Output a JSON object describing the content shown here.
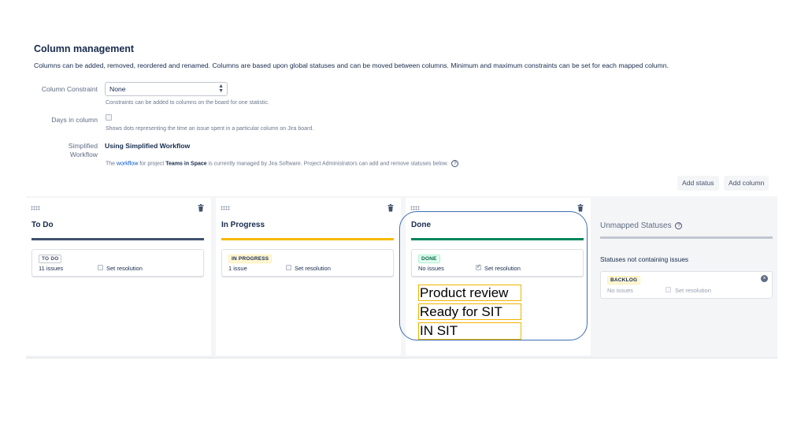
{
  "header": {
    "title": "Column management",
    "description": "Columns can be added, removed, reordered and renamed. Columns are based upon global statuses and can be moved between columns. Minimum and maximum constraints can be set for each mapped column."
  },
  "form": {
    "constraint_label": "Column Constraint",
    "constraint_value": "None",
    "constraint_help": "Constraints can be added to columns on the board for one statistic.",
    "days_label": "Days in column",
    "days_help": "Shows dots representing the time an issue spent in a particular column on Jira board.",
    "workflow_label_1": "Simplified",
    "workflow_label_2": "Workflow",
    "workflow_value": "Using Simplified Workflow",
    "workflow_help_pre": "The",
    "workflow_link": "workflow",
    "workflow_help_mid": "for project",
    "workflow_project": "Teams in Space",
    "workflow_help_post": "is currently managed by Jira Software. Project Administrators can add and remove statuses below.",
    "help_icon": "?"
  },
  "toolbar": {
    "add_status": "Add status",
    "add_column": "Add column"
  },
  "columns": [
    {
      "name": "To Do",
      "bar_color": "#42526e",
      "status": "TO DO",
      "issues": "11 issues",
      "resolution": "Set resolution",
      "resolution_checked": false,
      "lozenge_bg": "#ffffff",
      "lozenge_fg": "#42526e",
      "lozenge_border": "#c1c7d0"
    },
    {
      "name": "In Progress",
      "bar_color": "#f6b900",
      "status": "IN PROGRESS",
      "issues": "1 issue",
      "resolution": "Set resolution",
      "resolution_checked": false,
      "lozenge_bg": "#fff7d6",
      "lozenge_fg": "#172b4d",
      "lozenge_border": "#fff0b3"
    },
    {
      "name": "Done",
      "bar_color": "#00875a",
      "status": "DONE",
      "issues": "No issues",
      "resolution": "Set resolution",
      "resolution_checked": true,
      "lozenge_bg": "#e3fcef",
      "lozenge_fg": "#006644",
      "lozenge_border": "#abf5d1"
    }
  ],
  "unmapped": {
    "title": "Unmapped Statuses",
    "help_icon": "?",
    "subtitle": "Statuses not containing issues",
    "status": "BACKLOG",
    "issues": "No issues",
    "resolution": "Set resolution",
    "close_icon": "×"
  },
  "annotations": [
    "Product review",
    "Ready for SIT",
    "IN SIT"
  ],
  "icons": {
    "drag": "drag-handle-icon",
    "trash": "trash-icon",
    "help": "help-icon",
    "close": "close-circle-icon",
    "select_arrow": "⬍"
  }
}
